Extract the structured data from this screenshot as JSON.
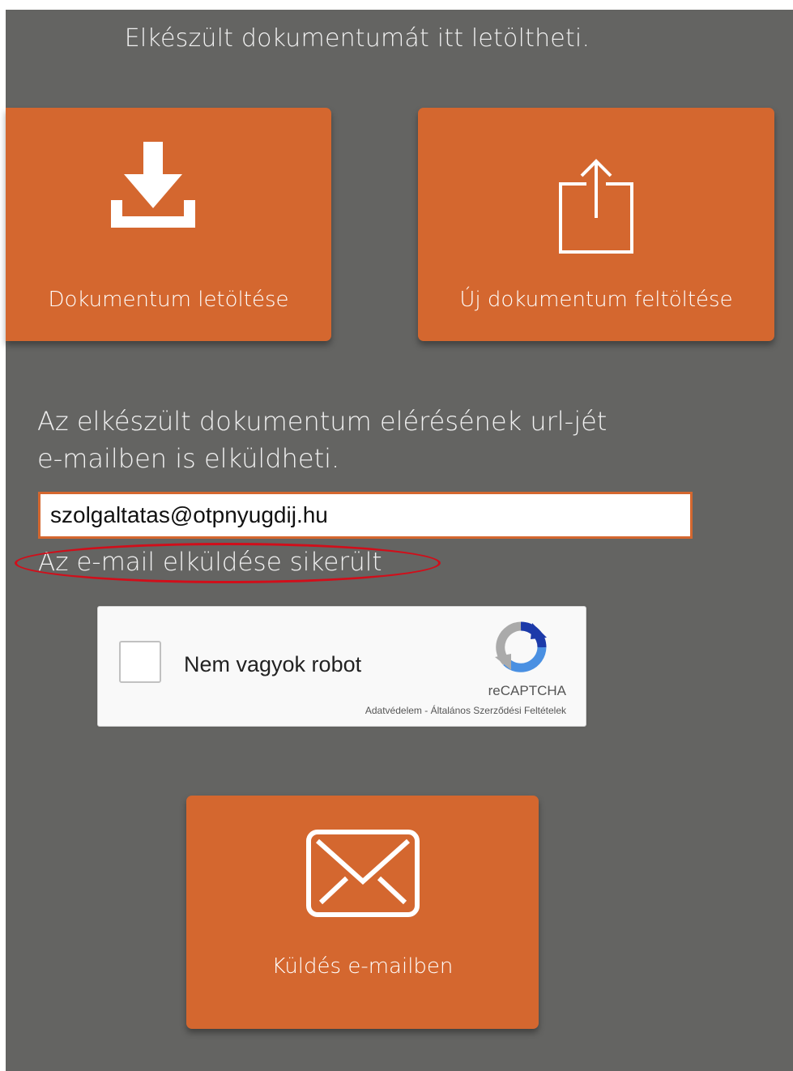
{
  "heading": "Elkészült dokumentumát itt letöltheti.",
  "tiles": {
    "download_label": "Dokumentum letöltése",
    "upload_label": "Új dokumentum feltöltése",
    "email_label": "Küldés e-mailben"
  },
  "info": {
    "line1": "Az elkészült dokumentum elérésének url-jét",
    "line2": "e-mailben is elküldheti."
  },
  "email_input": {
    "value": "szolgaltatas@otpnyugdij.hu"
  },
  "status_message": "Az e-mail elküldése sikerült",
  "captcha": {
    "label": "Nem vagyok robot",
    "brand": "reCAPTCHA",
    "privacy_link": "Adatvédelem",
    "separator": " - ",
    "terms_link": "Általános Szerződési Feltételek"
  },
  "colors": {
    "background": "#646462",
    "accent": "#d4672f",
    "highlight": "#d10e1a"
  }
}
